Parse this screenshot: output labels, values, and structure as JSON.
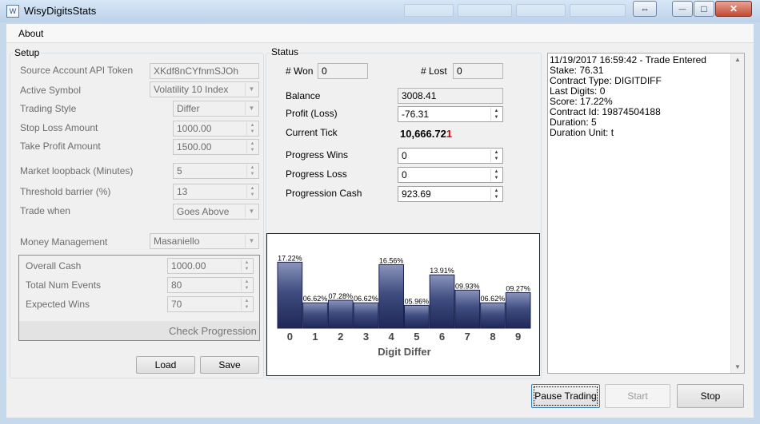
{
  "window": {
    "title": "WisyDigitsStats",
    "app_icon": "app-icon",
    "restore_symbol": "⇔",
    "minimize_symbol": "—",
    "maximize_symbol": "□",
    "close_symbol": "✕"
  },
  "menu": {
    "about": "About"
  },
  "setup": {
    "title": "Setup",
    "api_token_label": "Source Account API Token",
    "api_token_value": "XKdf8nCYfnmSJOh",
    "active_symbol_label": "Active Symbol",
    "active_symbol_value": "Volatility 10 Index",
    "trading_style_label": "Trading Style",
    "trading_style_value": "Differ",
    "stop_loss_label": "Stop Loss Amount",
    "stop_loss_value": "1000.00",
    "take_profit_label": "Take Profit Amount",
    "take_profit_value": "1500.00",
    "market_loopback_label": "Market loopback (Minutes)",
    "market_loopback_value": "5",
    "threshold_label": "Threshold barrier (%)",
    "threshold_value": "13",
    "trade_when_label": "Trade when",
    "trade_when_value": "Goes Above",
    "money_mgmt_label": "Money Management",
    "money_mgmt_value": "Masaniello",
    "overall_cash_label": "Overall Cash",
    "overall_cash_value": "1000.00",
    "total_events_label": "Total Num Events",
    "total_events_value": "80",
    "expected_wins_label": "Expected Wins",
    "expected_wins_value": "70",
    "check_progression": "Check Progression",
    "load": "Load",
    "save": "Save"
  },
  "status": {
    "title": "Status",
    "won_label": "# Won",
    "won_value": "0",
    "lost_label": "# Lost",
    "lost_value": "0",
    "balance_label": "Balance",
    "balance_value": "3008.41",
    "profit_label": "Profit (Loss)",
    "profit_value": "-76.31",
    "tick_label": "Current Tick",
    "tick_main": "10,666.72",
    "tick_last": "1",
    "progress_wins_label": "Progress Wins",
    "progress_wins_value": "0",
    "progress_loss_label": "Progress Loss",
    "progress_loss_value": "0",
    "progression_cash_label": "Progression Cash",
    "progression_cash_value": "923.69"
  },
  "chart_data": {
    "type": "bar",
    "categories": [
      "0",
      "1",
      "2",
      "3",
      "4",
      "5",
      "6",
      "7",
      "8",
      "9"
    ],
    "values": [
      17.22,
      6.62,
      7.28,
      6.62,
      16.56,
      5.96,
      13.91,
      9.93,
      6.62,
      9.27
    ],
    "data_labels": [
      "17.22%",
      "06.62%",
      "07.28%",
      "06.62%",
      "16.56%",
      "05.96%",
      "13.91%",
      "09.93%",
      "06.62%",
      "09.27%"
    ],
    "xlabel": "Digit Differ",
    "ylabel": "",
    "ylim": [
      0,
      20
    ],
    "grid": false,
    "legend": "none",
    "bar_color": "#3f4d80"
  },
  "log": {
    "lines": [
      "11/19/2017 16:59:42 - Trade Entered",
      "Stake: 76.31",
      "Contract Type: DIGITDIFF",
      "Last Digits: 0",
      "Score: 17.22%",
      "Contract Id: 19874504188",
      "Duration: 5",
      "Duration Unit: t"
    ]
  },
  "actions": {
    "pause": "Pause Trading",
    "start": "Start",
    "stop": "Stop"
  },
  "colors": {
    "tick_highlight": "#e00000",
    "chart_bar": "#3f4d80",
    "title_bar": "#c5d8ec"
  }
}
